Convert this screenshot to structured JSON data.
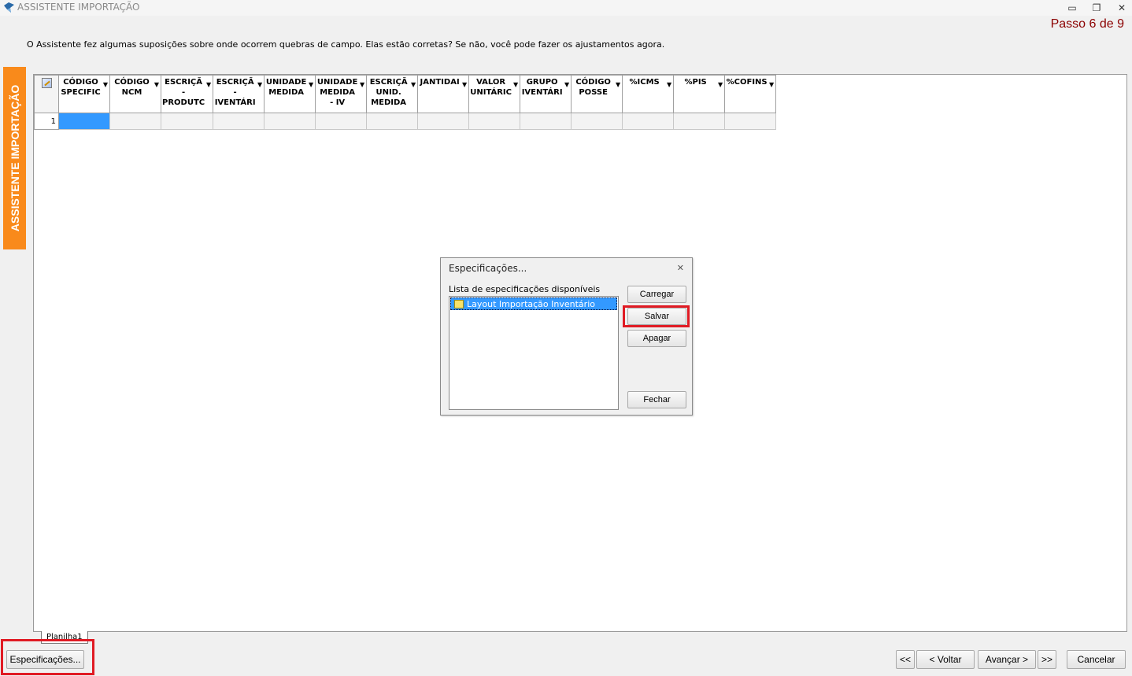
{
  "window": {
    "title": "ASSISTENTE IMPORTAÇÃO",
    "minimize": "▭",
    "restore": "❐",
    "close": "✕"
  },
  "wizard": {
    "step": "Passo 6 de 9",
    "intro": "O Assistente fez algumas suposições sobre onde ocorrem quebras de campo. Elas estão corretas? Se não, você pode fazer os ajustamentos agora.",
    "side_banner": "ASSISTENTE IMPORTAÇÃO"
  },
  "grid": {
    "columns": [
      [
        "CÓDIGO",
        "SPECIFIC"
      ],
      [
        "CÓDIGO",
        "NCM"
      ],
      [
        "ESCRIÇÃ",
        "-",
        "PRODUTC"
      ],
      [
        "ESCRIÇÃ",
        "-",
        "IVENTÁRI"
      ],
      [
        "UNIDADE",
        "MEDIDA"
      ],
      [
        "UNIDADE",
        "MEDIDA",
        "- IV"
      ],
      [
        "ESCRIÇÃ",
        "UNID.",
        "MEDIDA"
      ],
      [
        "JANTIDAI"
      ],
      [
        "VALOR",
        "UNITÁRIC"
      ],
      [
        "GRUPO",
        "IVENTÁRI"
      ],
      [
        "CÓDIGO",
        "POSSE"
      ],
      [
        "%ICMS"
      ],
      [
        "%PIS"
      ],
      [
        "%COFINS"
      ]
    ],
    "dropdown_arrow": "▼",
    "rows": [
      "1"
    ]
  },
  "sheet_tab": "Planilha1",
  "dialog": {
    "title": "Especificações...",
    "close": "✕",
    "list_label": "Lista de especificações disponíveis",
    "items": [
      "Layout Importação Inventário"
    ],
    "buttons": {
      "load": "Carregar",
      "save": "Salvar",
      "delete": "Apagar",
      "close": "Fechar"
    }
  },
  "footer": {
    "specs": "Especificações...",
    "first": "<<",
    "back": "< Voltar",
    "next": "Avançar >",
    "last": ">>",
    "cancel": "Cancelar"
  },
  "colors": {
    "step_text": "#8b0000",
    "banner": "#f98a1b",
    "highlight": "#e01b24",
    "selection": "#3399ff"
  }
}
